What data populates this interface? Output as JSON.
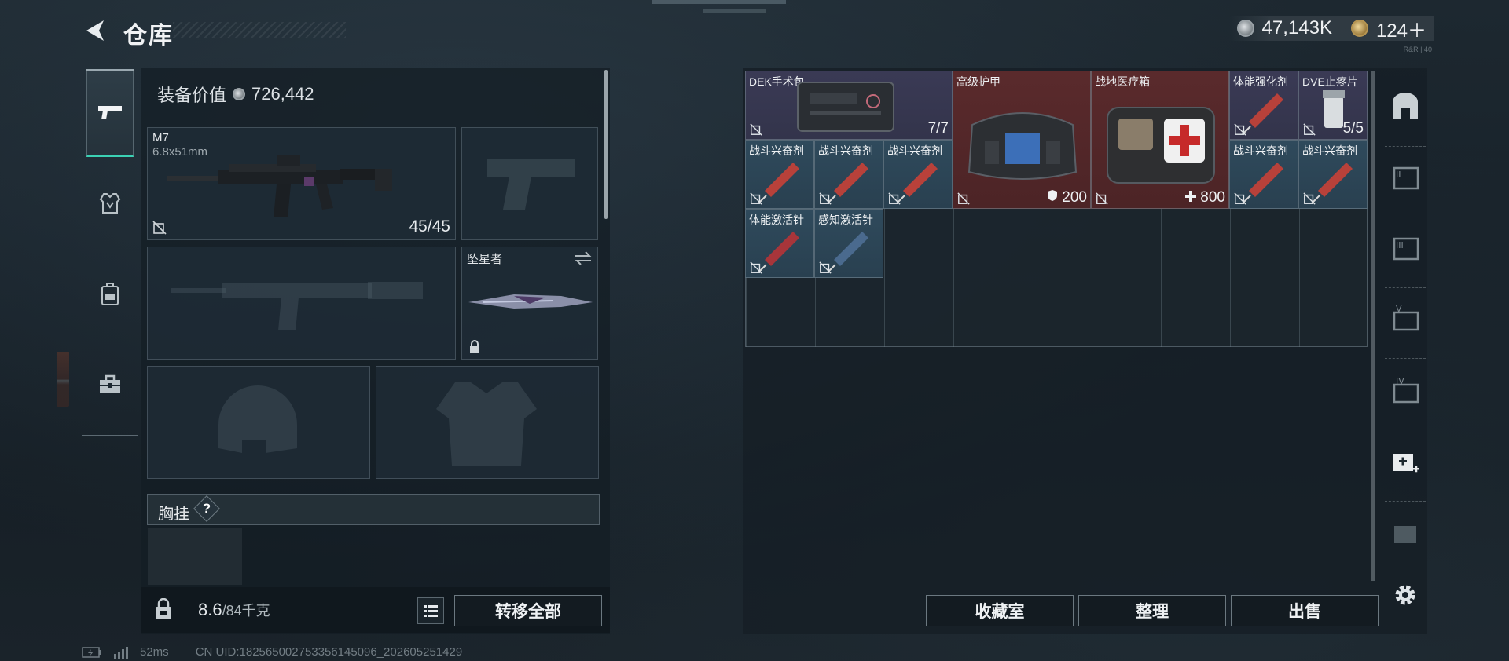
{
  "header": {
    "title": "仓库"
  },
  "currency": [
    {
      "icon": "silver-coin-icon",
      "value": "47,143K"
    },
    {
      "icon": "gold-coin-icon",
      "value": "124＋"
    }
  ],
  "equipment": {
    "value_label": "装备价值",
    "value": "726,442",
    "primary": {
      "name": "M7",
      "ammo": "6.8x51mm",
      "count": "45/45"
    },
    "melee": {
      "name": "坠星者"
    },
    "chest_rig": {
      "label": "胸挂",
      "help": "?"
    }
  },
  "bottom": {
    "weight": "8.6",
    "weight_max": "/84千克",
    "transfer_all": "转移全部"
  },
  "stash": {
    "items": [
      {
        "name": "DEK手术包",
        "count": "7/7"
      },
      {
        "name": "高级护甲",
        "count": "200"
      },
      {
        "name": "战地医疗箱",
        "count": "800"
      },
      {
        "name": "体能强化剂",
        "count": ""
      },
      {
        "name": "DVE止疼片",
        "count": "5/5"
      },
      {
        "name": "战斗兴奋剂",
        "count": ""
      },
      {
        "name": "战斗兴奋剂",
        "count": ""
      },
      {
        "name": "战斗兴奋剂",
        "count": ""
      },
      {
        "name": "战斗兴奋剂",
        "count": ""
      },
      {
        "name": "战斗兴奋剂",
        "count": ""
      },
      {
        "name": "体能激活针",
        "count": ""
      },
      {
        "name": "感知激活针",
        "count": ""
      }
    ],
    "buttons": {
      "collection": "收藏室",
      "sort": "整理",
      "sell": "出售"
    }
  },
  "status_bar": {
    "ping": "52ms",
    "uid": "CN UID:18256500275335614509​6_202605251429"
  },
  "version": "R&R | 40"
}
